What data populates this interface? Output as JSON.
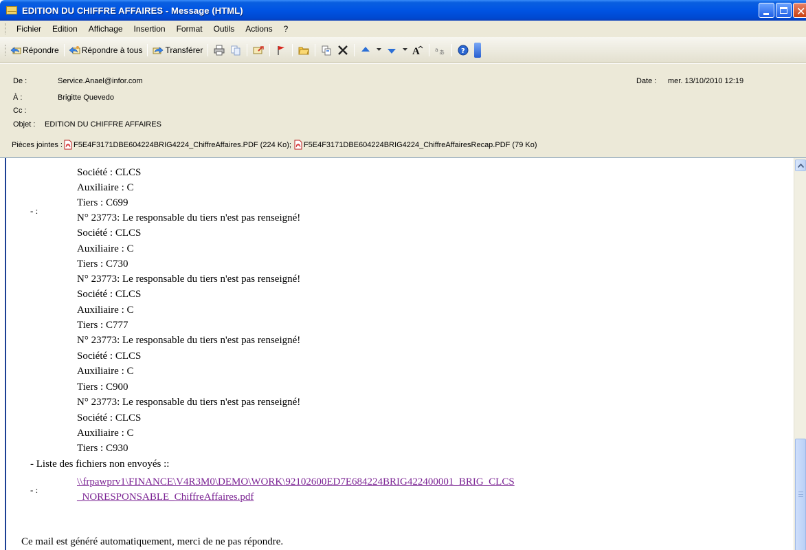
{
  "window": {
    "title": "EDITION DU CHIFFRE AFFAIRES - Message (HTML)"
  },
  "menu": {
    "items": [
      "Fichier",
      "Edition",
      "Affichage",
      "Insertion",
      "Format",
      "Outils",
      "Actions",
      "?"
    ]
  },
  "toolbar": {
    "reply_label": "Répondre",
    "reply_all_label": "Répondre à tous",
    "forward_label": "Transférer",
    "icons": [
      "print-icon",
      "copy-icon",
      "forward-mail-icon",
      "flag-icon",
      "open-folder-icon",
      "move-icon",
      "delete-icon",
      "previous-item-icon",
      "next-item-icon",
      "font-size-icon",
      "encoding-icon",
      "help-icon"
    ]
  },
  "header": {
    "from_label": "De :",
    "from_value": "Service.Anael@infor.com",
    "to_label": "À :",
    "to_value": "Brigitte Quevedo",
    "cc_label": "Cc :",
    "cc_value": "",
    "subject_label": "Objet :",
    "subject_value": "EDITION DU CHIFFRE AFFAIRES",
    "date_label": "Date :",
    "date_value": "mer. 13/10/2010 12:19",
    "attachments_label": "Pièces jointes :",
    "attachments": [
      {
        "name": "F5E4F3171DBE604224BRIG4224_ChiffreAffaires.PDF (224 Ko);"
      },
      {
        "name": "F5E4F3171DBE604224BRIG4224_ChiffreAffairesRecap.PDF (79 Ko)"
      }
    ]
  },
  "body": {
    "bullet_marker": "- :",
    "lines": [
      "Société : CLCS",
      "Auxiliaire : C",
      "Tiers : C699",
      "N° 23773: Le responsable du tiers n'est pas renseigné!",
      "Société : CLCS",
      "Auxiliaire : C",
      "Tiers : C730",
      "N° 23773: Le responsable du tiers n'est pas renseigné!",
      "Société : CLCS",
      "Auxiliaire : C",
      "Tiers : C777",
      "N° 23773: Le responsable du tiers n'est pas renseigné!",
      "Société : CLCS",
      "Auxiliaire : C",
      "Tiers : C900",
      "N° 23773: Le responsable du tiers n'est pas renseigné!",
      "Société : CLCS",
      "Auxiliaire : C",
      "Tiers : C930"
    ],
    "unsent_heading": "- Liste des fichiers non envoyés ::",
    "unsent_bullet": "- :",
    "unsent_link_line1": "\\\\frpawprv1\\FINANCE\\V4R3M0\\DEMO\\WORK\\92102600ED7E684224BRIG422400001_BRIG_CLCS",
    "unsent_link_line2": "_NORESPONSABLE_ChiffreAffaires.pdf",
    "footer": "Ce mail est généré automatiquement, merci de ne pas répondre."
  }
}
